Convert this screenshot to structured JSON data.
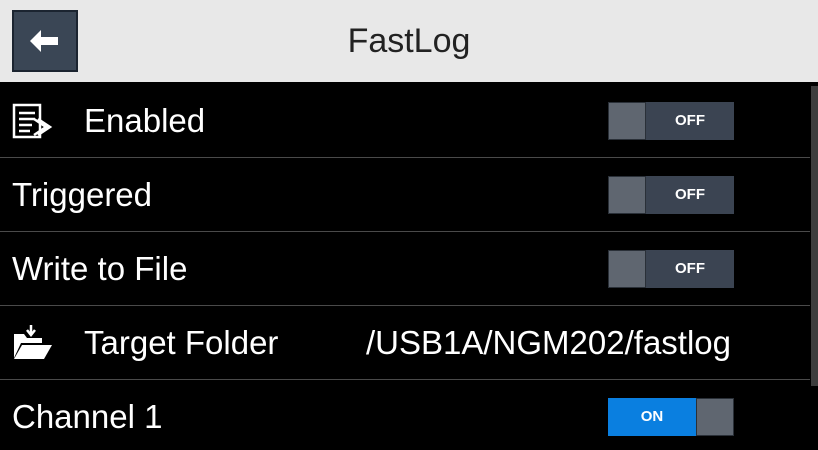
{
  "header": {
    "title": "FastLog",
    "back_icon": "arrow-left-icon"
  },
  "rows": [
    {
      "label": "Enabled",
      "icon": "data-log-icon",
      "control": "toggle",
      "value": "OFF"
    },
    {
      "label": "Triggered",
      "control": "toggle",
      "value": "OFF"
    },
    {
      "label": "Write to File",
      "control": "toggle",
      "value": "OFF"
    },
    {
      "label": "Target Folder",
      "icon": "open-folder-icon",
      "control": "text",
      "value": "/USB1A/NGM202/fastlog"
    },
    {
      "label": "Channel 1",
      "control": "toggle",
      "value": "ON"
    }
  ],
  "colors": {
    "background": "#000000",
    "header": "#e8e8e8",
    "toggle_on": "#0a7fe0",
    "toggle_off": "#3b4452"
  }
}
